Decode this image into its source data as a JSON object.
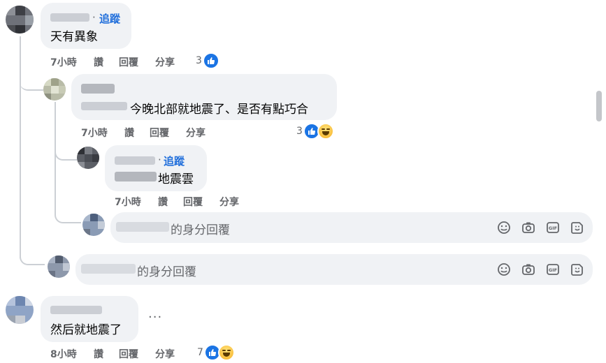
{
  "comments": [
    {
      "follow_label": "追蹤",
      "name_sep": "·",
      "text": "天有異象",
      "time": "7小時",
      "like_label": "讚",
      "reply_label": "回覆",
      "share_label": "分享",
      "reaction_count": "3",
      "reactions": [
        "like"
      ]
    },
    {
      "text": "今晚北部就地震了、是否有點巧合",
      "time": "7小時",
      "like_label": "讚",
      "reply_label": "回覆",
      "share_label": "分享",
      "reaction_count": "3",
      "reactions": [
        "like",
        "haha"
      ]
    },
    {
      "follow_label": "追蹤",
      "name_sep": "·",
      "text": "地震雲",
      "time": "7小時",
      "like_label": "讚",
      "reply_label": "回覆",
      "share_label": "分享"
    },
    {
      "text": "然后就地震了",
      "time": "8小時",
      "like_label": "讚",
      "reply_label": "回覆",
      "share_label": "分享",
      "reaction_count": "7",
      "reactions": [
        "like",
        "haha"
      ],
      "more_label": "···"
    }
  ],
  "reply_boxes": [
    {
      "placeholder_suffix": "的身分回覆"
    },
    {
      "placeholder_suffix": "的身分回覆"
    }
  ],
  "composer_icons": [
    "emoji-icon",
    "camera-icon",
    "gif-icon",
    "sticker-icon"
  ],
  "colors": {
    "accent": "#216fdb",
    "like_blue": "#1b74e4",
    "bubble_bg": "#f0f2f5",
    "meta_gray": "#65676b"
  }
}
